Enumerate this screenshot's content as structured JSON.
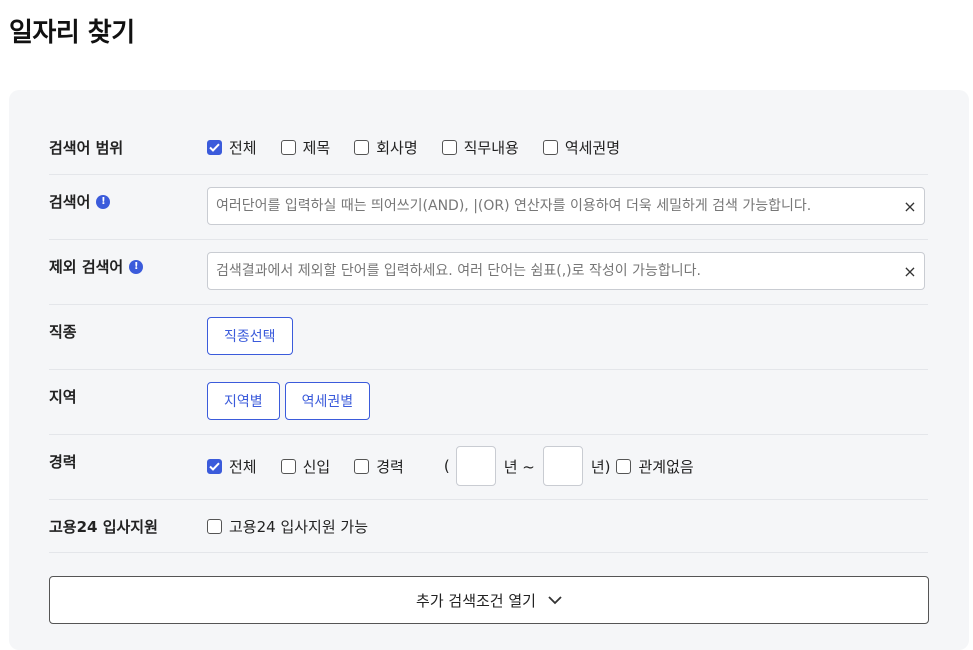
{
  "page": {
    "title": "일자리 찾기"
  },
  "search_scope": {
    "label": "검색어 범위",
    "options": [
      {
        "label": "전체",
        "checked": true
      },
      {
        "label": "제목",
        "checked": false
      },
      {
        "label": "회사명",
        "checked": false
      },
      {
        "label": "직무내용",
        "checked": false
      },
      {
        "label": "역세권명",
        "checked": false
      }
    ]
  },
  "keyword": {
    "label": "검색어",
    "info_icon": "info-icon",
    "value": "",
    "placeholder": "여러단어를 입력하실 때는 띄어쓰기(AND), |(OR) 연산자를 이용하여 더욱 세밀하게 검색 가능합니다.",
    "clear_icon": "×"
  },
  "exclude_keyword": {
    "label": "제외 검색어",
    "info_icon": "info-icon",
    "value": "",
    "placeholder": "검색결과에서 제외할 단어를 입력하세요. 여러 단어는 쉼표(,)로 작성이 가능합니다.",
    "clear_icon": "×"
  },
  "job_type": {
    "label": "직종",
    "button": "직종선택"
  },
  "region": {
    "label": "지역",
    "buttons": [
      "지역별",
      "역세권별"
    ]
  },
  "career": {
    "label": "경력",
    "options": [
      {
        "label": "전체",
        "checked": true
      },
      {
        "label": "신입",
        "checked": false
      },
      {
        "label": "경력",
        "checked": false
      }
    ],
    "open_paren": "(",
    "from_value": "",
    "from_unit": "년 ~",
    "to_value": "",
    "to_unit": "년)",
    "no_matter": {
      "label": "관계없음",
      "checked": false
    }
  },
  "employment24": {
    "label": "고용24 입사지원",
    "option": {
      "label": "고용24 입사지원 가능",
      "checked": false
    }
  },
  "more_search": {
    "label": "추가 검색조건 열기",
    "icon": "chevron-down-icon"
  },
  "colors": {
    "accent": "#3b5bdb",
    "panel_bg": "#f5f6f8",
    "border": "#c9ccd2"
  }
}
